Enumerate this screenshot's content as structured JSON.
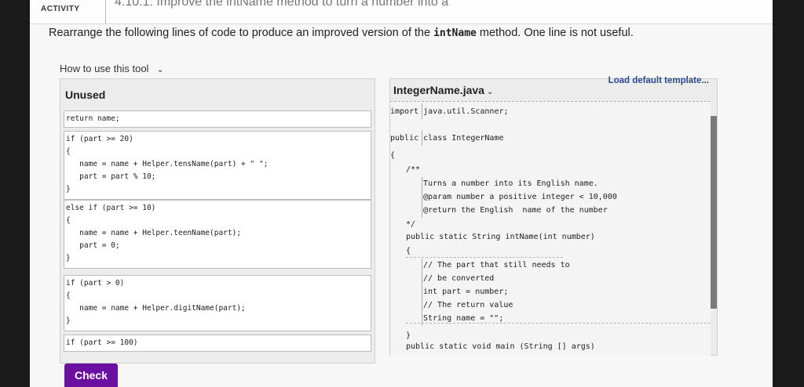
{
  "header": {
    "activity_label": "ACTIVITY",
    "title": "4.10.1: Improve the intName method to turn a number into a"
  },
  "instruction": {
    "before": "Rearrange the following lines of code to produce an improved version of the ",
    "code": "intName",
    "after": " method. One line is not useful."
  },
  "howto": {
    "label": "How to use this tool",
    "icon": "chevron-down-icon"
  },
  "unused": {
    "title": "Unused",
    "blocks": [
      {
        "lines": [
          "return name;"
        ]
      },
      {
        "lines": [
          "if (part >= 20)",
          "{",
          "   name = name + Helper.tensName(part) + \" \";",
          "   part = part % 10;",
          "}"
        ]
      },
      {
        "lines": [
          "else if (part >= 10)",
          "{",
          "   name = name + Helper.teenName(part);",
          "   part = 0;",
          "}"
        ]
      },
      {
        "lines": [
          "if (part > 0)",
          "{",
          "   name = name + Helper.digitName(part);",
          "}"
        ]
      },
      {
        "lines": [
          "if (part >= 100)"
        ]
      }
    ]
  },
  "editor": {
    "file_name": "IntegerName.java",
    "load_template": "Load default template...",
    "lines": [
      "import java.util.Scanner;",
      "public class IntegerName",
      "{",
      "/**",
      "Turns a number into its English name.",
      "@param number a positive integer < 10,000",
      "@return the English  name of the number",
      "*/",
      "public static String intName(int number)",
      "{",
      "// The part that still needs to",
      "// be converted",
      "int part = number;",
      "// The return value",
      "String name = \"\";",
      "}",
      "public static void main (String [] args)"
    ]
  },
  "check_button": {
    "label": "Check",
    "color": "#6b0fa0"
  }
}
